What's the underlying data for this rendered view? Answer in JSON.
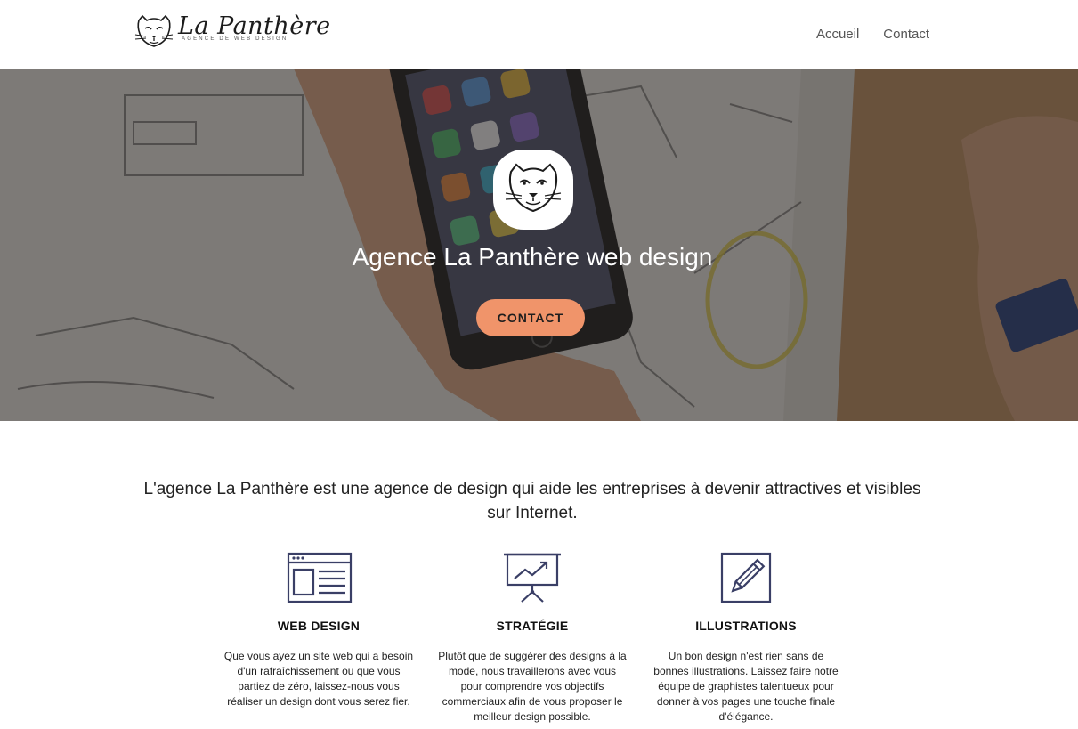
{
  "header": {
    "brand_name": "La Panthère",
    "brand_tagline": "AGENCE DE WEB DESIGN",
    "nav": [
      {
        "label": "Accueil"
      },
      {
        "label": "Contact"
      }
    ]
  },
  "hero": {
    "title": "Agence La Panthère web design",
    "cta_label": "CONTACT",
    "cta_color": "#f0946a"
  },
  "intro": {
    "text": "L'agence La Panthère est une agence de design qui aide les entreprises à devenir attractives et visibles sur Internet."
  },
  "services": [
    {
      "icon": "browser-window-icon",
      "title": "WEB DESIGN",
      "text": "Que vous ayez un site web qui a besoin d'un rafraîchissement ou que vous partiez de zéro, laissez-nous vous réaliser un design dont vous serez fier."
    },
    {
      "icon": "presentation-chart-icon",
      "title": "STRATÉGIE",
      "text": "Plutôt que de suggérer des designs à la mode, nous travaillerons avec vous pour comprendre vos objectifs commerciaux afin de vous proposer le meilleur design possible."
    },
    {
      "icon": "pencil-square-icon",
      "title": "ILLUSTRATIONS",
      "text": "Un bon design n'est rien sans de bonnes illustrations. Laissez faire notre équipe de graphistes talentueux pour donner à vos pages une touche finale d'élégance."
    }
  ],
  "colors": {
    "accent": "#f0946a",
    "icon_stroke": "#3a3f66"
  }
}
